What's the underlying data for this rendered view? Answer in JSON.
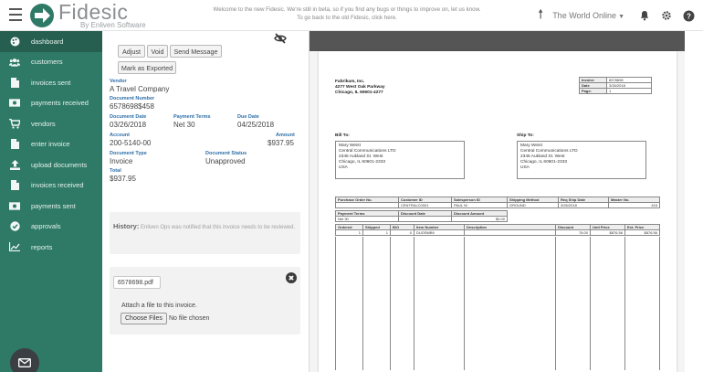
{
  "header": {
    "brand": "Fidesic",
    "brand_sub": "By Enliven Software",
    "welcome_line1": "Welcome to the new Fidesic. We're still in beta, so if you find any bugs or things to improve on, let us know.",
    "welcome_line2": "To go back to the old Fidesic, click here.",
    "company_selector": "The World Online",
    "icons": [
      "up-arrow-icon",
      "bell-icon",
      "gear-icon",
      "help-icon"
    ]
  },
  "sidebar": {
    "items": [
      {
        "label": "dashboard",
        "icon": "palette-icon"
      },
      {
        "label": "customers",
        "icon": "users-icon"
      },
      {
        "label": "invoices sent",
        "icon": "document-icon"
      },
      {
        "label": "payments received",
        "icon": "money-icon"
      },
      {
        "label": "vendors",
        "icon": "cart-icon"
      },
      {
        "label": "enter invoice",
        "icon": "document-icon"
      },
      {
        "label": "upload documents",
        "icon": "upload-icon"
      },
      {
        "label": "invoices received",
        "icon": "document-icon"
      },
      {
        "label": "payments sent",
        "icon": "money-icon"
      },
      {
        "label": "approvals",
        "icon": "check-circle-icon"
      },
      {
        "label": "reports",
        "icon": "chart-icon"
      }
    ],
    "colors": {
      "background": "#2f7a66",
      "active": "#265f50"
    }
  },
  "actions": {
    "adjust": "Adjust",
    "void": "Void",
    "send_message": "Send Message",
    "mark_exported": "Mark as Exported"
  },
  "details": {
    "vendor_label": "Vendor",
    "vendor": "A Travel Company",
    "doc_number_label": "Document Number",
    "doc_number": "6578698$458",
    "doc_date_label": "Document Date",
    "doc_date": "03/26/2018",
    "terms_label": "Payment Terms",
    "terms": "Net 30",
    "due_label": "Due Date",
    "due": "04/25/2018",
    "account_label": "Account",
    "account": "200-5140-00",
    "amount_label": "Amount",
    "amount": "$937.95",
    "doc_type_label": "Document Type",
    "doc_type": "Invoice",
    "status_label": "Document Status",
    "status": "Unapproved",
    "total_label": "Total",
    "total": "$937.95"
  },
  "history": {
    "title": "History:",
    "text": "Enliven Ops was notified that this invoice needs to be reviewed."
  },
  "attachment": {
    "file_name": "6578698.pdf",
    "attach_text": "Attach a file to this invoice.",
    "choose_label": "Choose Files",
    "no_file": "No file chosen"
  },
  "document": {
    "company": "Fabrikam, Inc.",
    "street": "4277 West Oak Parkway",
    "city": "Chicago, IL  60601-4277",
    "invoice_label": "Invoice",
    "invoice_no": "6578698",
    "date_label": "Date",
    "date": "3/26/2018",
    "page_label": "Page:",
    "page": "1",
    "bill_to_label": "Bill To:",
    "ship_to_label": "Ship To:",
    "bill_to": [
      "Mary Weist",
      "Central Communications LTD",
      "2345 Aukland St. West",
      "Chicago, IL   60601-2333",
      "USA"
    ],
    "ship_to": [
      "Mary Weist",
      "Central Communications LTD",
      "2345 Aukland St. West",
      "Chicago, IL   60601-2333",
      "USA"
    ],
    "order_headers": [
      "Purchase Order No.",
      "Customer ID",
      "Salesperson ID",
      "Shipping Method",
      "Req Ship Date",
      "Master No."
    ],
    "order_values": [
      "",
      "CENTRALC0001",
      "PAUL W",
      "GROUND",
      "3/26/2018",
      "416"
    ],
    "terms_headers": [
      "Payment Terms",
      "Discount Date",
      "Discount Amount"
    ],
    "terms_values": [
      "Net 30",
      "",
      "$0.00"
    ],
    "line_headers": [
      "Ordered",
      "Shipped",
      "B/O",
      "Item Number",
      "Description",
      "Discount",
      "Unit Price",
      "Ext. Price"
    ],
    "line_values": [
      "1",
      "1",
      "0",
      "DUOSMB9",
      "",
      "76.00",
      "$876.56",
      "$876.56"
    ]
  }
}
